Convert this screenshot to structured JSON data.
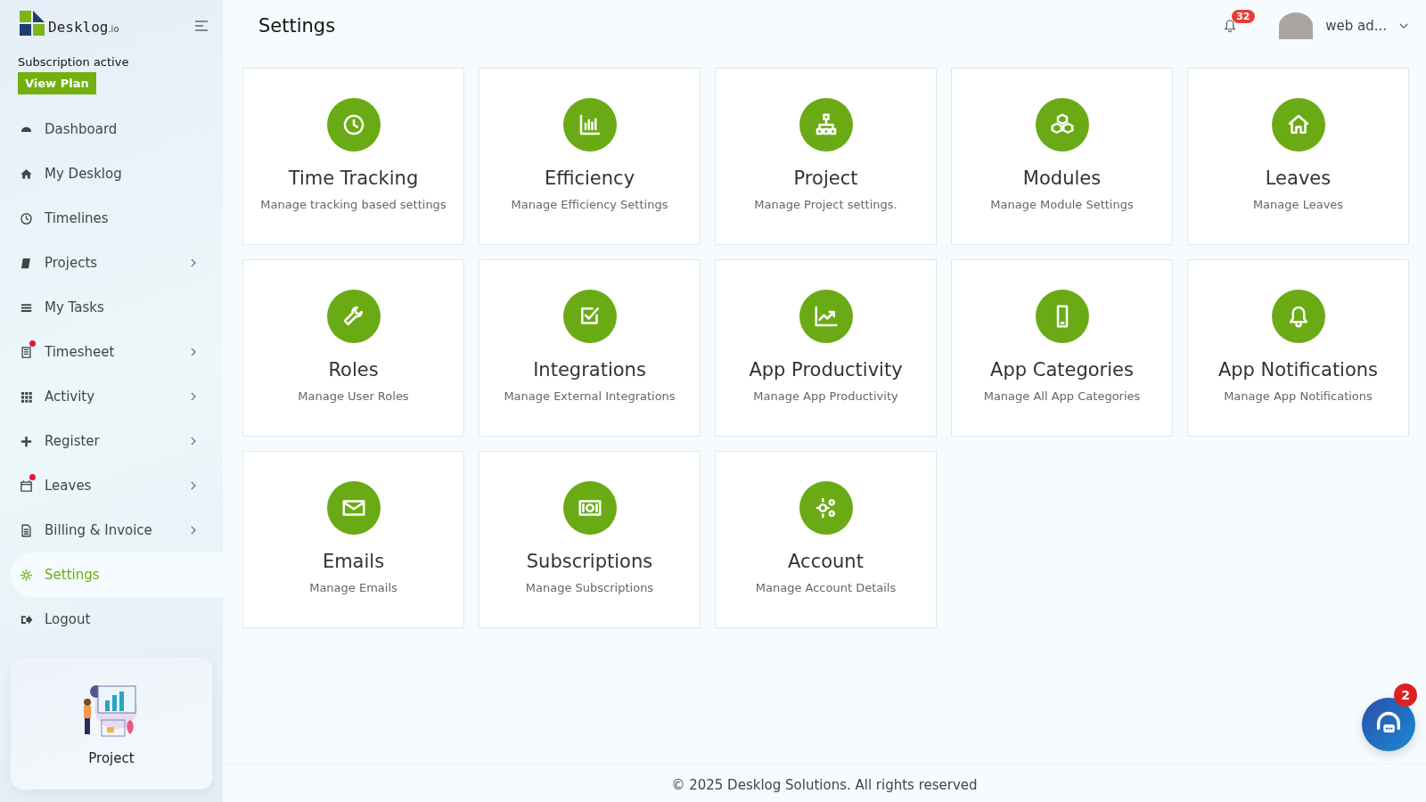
{
  "brand": {
    "name": "Desklog",
    "suffix": ".io"
  },
  "subscription": {
    "status": "Subscription active",
    "button": "View Plan"
  },
  "sidebar": {
    "items": [
      {
        "label": "Dashboard",
        "selected": false,
        "has_submenu": false,
        "notification_dot": false
      },
      {
        "label": "My Desklog",
        "selected": false,
        "has_submenu": false,
        "notification_dot": false
      },
      {
        "label": "Timelines",
        "selected": false,
        "has_submenu": false,
        "notification_dot": false
      },
      {
        "label": "Projects",
        "selected": false,
        "has_submenu": true,
        "notification_dot": false
      },
      {
        "label": "My Tasks",
        "selected": false,
        "has_submenu": false,
        "notification_dot": false
      },
      {
        "label": "Timesheet",
        "selected": false,
        "has_submenu": true,
        "notification_dot": true
      },
      {
        "label": "Activity",
        "selected": false,
        "has_submenu": true,
        "notification_dot": false
      },
      {
        "label": "Register",
        "selected": false,
        "has_submenu": true,
        "notification_dot": false
      },
      {
        "label": "Leaves",
        "selected": false,
        "has_submenu": true,
        "notification_dot": true
      },
      {
        "label": "Billing & Invoice",
        "selected": false,
        "has_submenu": true,
        "notification_dot": false
      },
      {
        "label": "Settings",
        "selected": true,
        "has_submenu": false,
        "notification_dot": false
      },
      {
        "label": "Logout",
        "selected": false,
        "has_submenu": false,
        "notification_dot": false
      }
    ]
  },
  "promo_card": {
    "label": "Project"
  },
  "header": {
    "title": "Settings",
    "notification_count": "32",
    "user_name": "web ad..."
  },
  "cards": [
    {
      "title": "Time Tracking",
      "description": "Manage tracking based settings"
    },
    {
      "title": "Efficiency",
      "description": "Manage Efficiency Settings"
    },
    {
      "title": "Project",
      "description": "Manage Project settings."
    },
    {
      "title": "Modules",
      "description": "Manage Module Settings"
    },
    {
      "title": "Leaves",
      "description": "Manage Leaves"
    },
    {
      "title": "Roles",
      "description": "Manage User Roles"
    },
    {
      "title": "Integrations",
      "description": "Manage External Integrations"
    },
    {
      "title": "App Productivity",
      "description": "Manage App Productivity"
    },
    {
      "title": "App Categories",
      "description": "Manage All App Categories"
    },
    {
      "title": "App Notifications",
      "description": "Manage App Notifications"
    },
    {
      "title": "Emails",
      "description": "Manage Emails"
    },
    {
      "title": "Subscriptions",
      "description": "Manage Subscriptions"
    },
    {
      "title": "Account",
      "description": "Manage Account Details"
    }
  ],
  "footer": "© 2025 Desklog Solutions. All rights reserved",
  "chat": {
    "badge": "2"
  }
}
